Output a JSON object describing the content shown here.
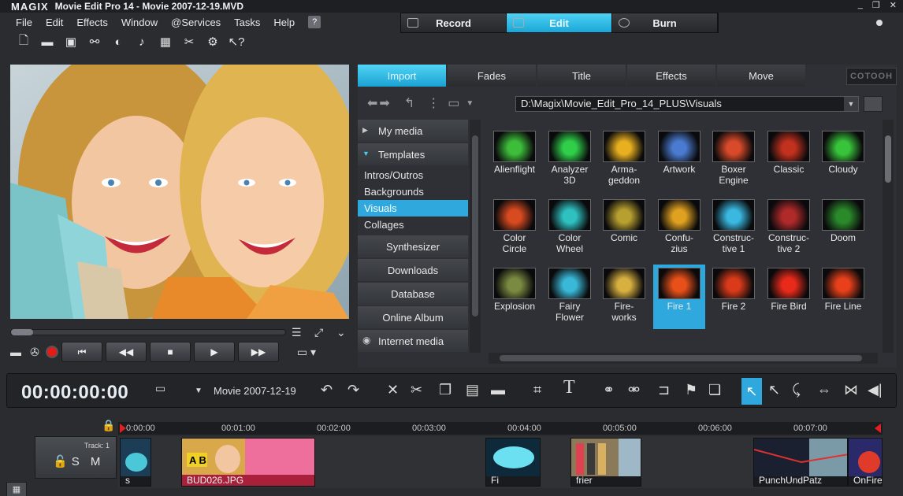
{
  "titlebar": {
    "brand": "MAGIX",
    "title": "Movie Edit Pro 14 - Movie 2007-12-19.MVD",
    "controls": [
      "_",
      "❐",
      "✕"
    ]
  },
  "menu": [
    "File",
    "Edit",
    "Effects",
    "Window",
    "@Services",
    "Tasks",
    "Help"
  ],
  "modes": [
    {
      "label": "Record",
      "icon": "film-icon"
    },
    {
      "label": "Edit",
      "icon": "monitor-icon"
    },
    {
      "label": "Burn",
      "icon": "disc-icon"
    }
  ],
  "toolbar_icons": [
    "new-file-icon",
    "open-folder-icon",
    "save-icon",
    "export-icon",
    "burn-icon",
    "music-icon",
    "mixer-icon",
    "cut-icon",
    "settings-icon",
    "help-icon"
  ],
  "media_pool": {
    "tabs": [
      "Import",
      "Fades",
      "Title",
      "Effects",
      "Move"
    ],
    "cotooh_label": "COTOOH",
    "path": "D:\\Magix\\Movie_Edit_Pro_14_PLUS\\Visuals",
    "tree": {
      "my_media": "My media",
      "templates": "Templates",
      "sub_items": [
        "Intros/Outros",
        "Backgrounds",
        "Visuals",
        "Collages"
      ],
      "sections": [
        "Synthesizer",
        "Downloads",
        "Database",
        "Online Album"
      ],
      "internet": "Internet media"
    },
    "visuals": [
      {
        "l1": "Alienflight",
        "l2": "",
        "color": "#3dbd3a"
      },
      {
        "l1": "Analyzer",
        "l2": "3D",
        "color": "#2fcf4a"
      },
      {
        "l1": "Arma-",
        "l2": "geddon",
        "color": "#e8b020"
      },
      {
        "l1": "Artwork",
        "l2": "",
        "color": "#4a7bd0"
      },
      {
        "l1": "Boxer",
        "l2": "Engine",
        "color": "#d84a2a"
      },
      {
        "l1": "Classic",
        "l2": "",
        "color": "#c2301e"
      },
      {
        "l1": "Cloudy",
        "l2": "",
        "color": "#38c43a"
      },
      {
        "l1": "Color",
        "l2": "Circle",
        "color": "#d84a20"
      },
      {
        "l1": "Color",
        "l2": "Wheel",
        "color": "#2fc0c0"
      },
      {
        "l1": "Comic",
        "l2": "",
        "color": "#b8a030"
      },
      {
        "l1": "Confu-",
        "l2": "zius",
        "color": "#e0a020"
      },
      {
        "l1": "Construc-",
        "l2": "tive 1",
        "color": "#3ab8e0"
      },
      {
        "l1": "Construc-",
        "l2": "tive 2",
        "color": "#b02a2a"
      },
      {
        "l1": "Doom",
        "l2": "",
        "color": "#2a8a2a"
      },
      {
        "l1": "Explosion",
        "l2": "",
        "color": "#7a8a40"
      },
      {
        "l1": "Fairy",
        "l2": "Flower",
        "color": "#3ab8d8"
      },
      {
        "l1": "Fire-",
        "l2": "works",
        "color": "#d8b040"
      },
      {
        "l1": "Fire 1",
        "l2": "",
        "color": "#e8501a"
      },
      {
        "l1": "Fire 2",
        "l2": "",
        "color": "#d83a1a"
      },
      {
        "l1": "Fire Bird",
        "l2": "",
        "color": "#e82a1a"
      },
      {
        "l1": "Fire Line",
        "l2": "",
        "color": "#e8401a"
      }
    ],
    "selected_index": 17
  },
  "transport": [
    "⏮",
    "◀◀",
    "■",
    "▶",
    "▶▶"
  ],
  "timeline_bar": {
    "timecode": "00:00:00:00",
    "project": "Movie 2007-12-19"
  },
  "timeline": {
    "ticks": [
      "0:00:00",
      "00:01:00",
      "00:02:00",
      "00:03:00",
      "00:04:00",
      "00:05:00",
      "00:06:00",
      "00:07:00"
    ],
    "track_label": "Track:  1",
    "track_controls": "S M",
    "clips": [
      {
        "name": "s",
        "kind": "dark"
      },
      {
        "name": "BUD026.JPG",
        "kind": "pink"
      },
      {
        "name": "Fi",
        "kind": "dark"
      },
      {
        "name": "frier",
        "kind": "dark"
      },
      {
        "name": "PunchUndPatz",
        "kind": "dark"
      },
      {
        "name": "OnFire",
        "kind": "dark"
      }
    ]
  }
}
